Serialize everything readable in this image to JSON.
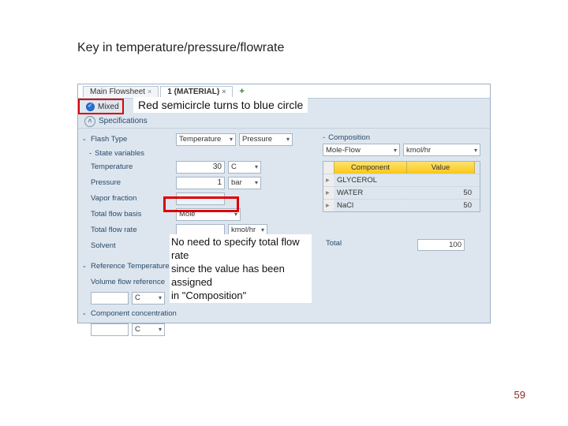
{
  "slide": {
    "title": "Key in temperature/pressure/flowrate"
  },
  "tabs": {
    "t1": "Main Flowsheet",
    "t2": "1 (MATERIAL)",
    "plus": "+"
  },
  "status": {
    "text": "Mixed"
  },
  "callout1": "Red semicircle turns to blue circle",
  "section": {
    "hdr": "Specifications"
  },
  "flash": {
    "label": "Flash Type",
    "opt1": "Temperature",
    "opt2": "Pressure"
  },
  "state": {
    "hdr": "State variables",
    "temp_lbl": "Temperature",
    "temp_val": "30",
    "temp_unit": "C",
    "pres_lbl": "Pressure",
    "pres_val": "1",
    "pres_unit": "bar",
    "vap_lbl": "Vapor fraction",
    "basis_lbl": "Total flow basis",
    "basis_val": "Mole",
    "rate_lbl": "Total flow rate",
    "rate_unit": "kmol/hr",
    "solvent_lbl": "Solvent"
  },
  "ref": {
    "temp_lbl": "Reference Temperature",
    "vol_lbl": "Volume flow reference",
    "unit": "C",
    "conc_lbl": "Component concentration"
  },
  "callout2": {
    "l1": "No need to specify total flow rate",
    "l2": "since the value has been assigned",
    "l3": "in \"Composition\""
  },
  "comp": {
    "hdr": "Composition",
    "basis": "Mole-Flow",
    "basis_unit": "kmol/hr",
    "col1": "Component",
    "col2": "Value",
    "r1": "GLYCEROL",
    "r2": "WATER",
    "r2v": "50",
    "r3": "NaCl",
    "r3v": "50",
    "total_lbl": "Total",
    "total_val": "100"
  },
  "page": "59"
}
